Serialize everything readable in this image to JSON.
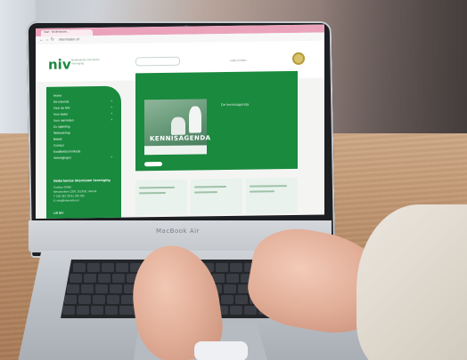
{
  "laptop": {
    "brand_label": "MacBook Air"
  },
  "browser": {
    "tab_title": "Start - Nederlandse...",
    "url": "internisten.nl"
  },
  "site": {
    "logo": "niv",
    "logo_subtitle": "Nederlandse Internisten Vereniging",
    "header_links": "Login     Contact",
    "sidebar_items": [
      {
        "label": "Home",
        "expandable": false
      },
      {
        "label": "De Internist",
        "expandable": true
      },
      {
        "label": "Over de NIV",
        "expandable": true
      },
      {
        "label": "Voor leden",
        "expandable": true
      },
      {
        "label": "Voor niet-leden",
        "expandable": true
      },
      {
        "label": "Zo opleiding",
        "expandable": false
      },
      {
        "label": "Wetenschap",
        "expandable": false
      },
      {
        "label": "Beleid",
        "expandable": false
      },
      {
        "label": "Contact",
        "expandable": false
      },
      {
        "label": "Kwaliteitscommissie",
        "expandable": false
      },
      {
        "label": "Verenigingen",
        "expandable": true
      }
    ],
    "sidebar_heading": "Nederlandse Internisten Vereniging",
    "sidebar_contact": [
      "Postbus 20066",
      "Mercatorlaan 1200, 3528 BL Utrecht",
      "T: 030 282 3326 | 030 282",
      "E: info@internisten.nl"
    ],
    "sidebar_footer": "LID NIV",
    "hero_caption": "KENNISAGENDA",
    "hero_title": "De kennisagenda"
  },
  "colors": {
    "brand_green": "#1a8a3e",
    "browser_tab_pink": "#eaa3bb"
  }
}
